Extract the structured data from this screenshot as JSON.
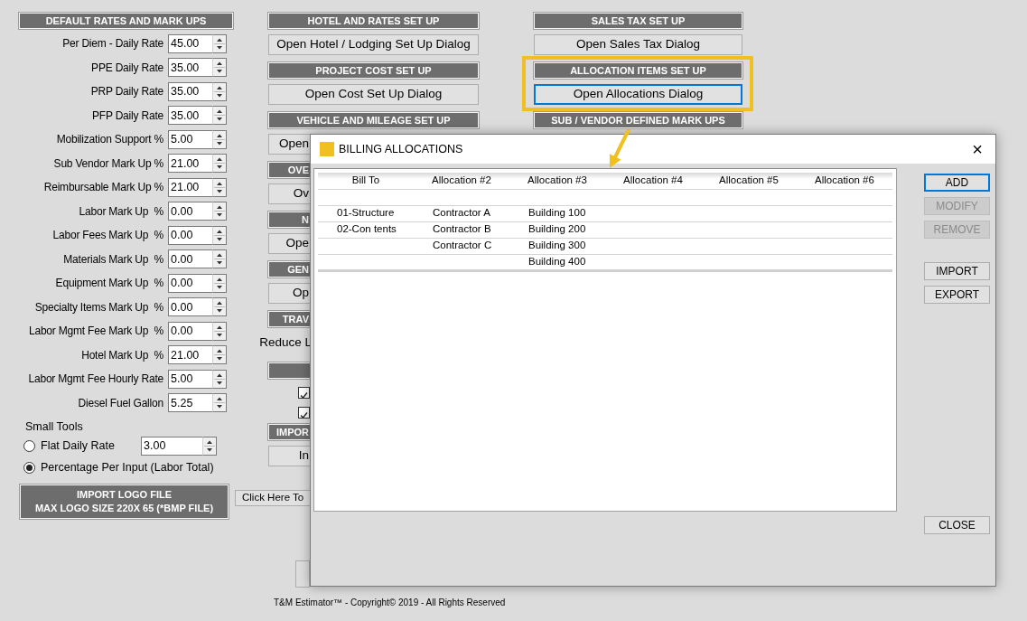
{
  "left_panel": {
    "header": "DEFAULT RATES AND MARK UPS",
    "rates": [
      {
        "label": "Per Diem - Daily Rate",
        "value": "45.00"
      },
      {
        "label": "PPE Daily Rate",
        "value": "35.00"
      },
      {
        "label": "PRP Daily Rate",
        "value": "35.00"
      },
      {
        "label": "PFP Daily Rate",
        "value": "35.00"
      },
      {
        "label": "Mobilization Support %",
        "value": "5.00"
      },
      {
        "label": "Sub Vendor Mark Up %",
        "value": "21.00"
      },
      {
        "label": "Reimbursable Mark Up %",
        "value": "21.00"
      },
      {
        "label": "Labor Mark Up  %",
        "value": "0.00"
      },
      {
        "label": "Labor Fees Mark Up  %",
        "value": "0.00"
      },
      {
        "label": "Materials Mark Up  %",
        "value": "0.00"
      },
      {
        "label": "Equipment Mark Up  %",
        "value": "0.00"
      },
      {
        "label": "Specialty Items Mark Up  %",
        "value": "0.00"
      },
      {
        "label": "Labor Mgmt Fee Mark Up  %",
        "value": "0.00"
      },
      {
        "label": "Hotel Mark Up  %",
        "value": "21.00"
      },
      {
        "label": "Labor Mgmt Fee Hourly Rate",
        "value": "5.00"
      },
      {
        "label": "Diesel Fuel Gallon",
        "value": "5.25"
      }
    ],
    "small_tools": {
      "label": "Small Tools",
      "options": [
        {
          "label": "Flat Daily Rate",
          "selected": false,
          "value": "3.00"
        },
        {
          "label": "Percentage Per Input (Labor Total)",
          "selected": true
        }
      ]
    },
    "logo_button": [
      "IMPORT LOGO FILE",
      "MAX LOGO SIZE 220X 65 (*BMP FILE)"
    ]
  },
  "middle_panel": {
    "items": [
      {
        "kind": "header",
        "text": "HOTEL AND RATES SET UP"
      },
      {
        "kind": "button",
        "text": "Open Hotel / Lodging Set Up Dialog"
      },
      {
        "kind": "header",
        "text": "PROJECT COST SET UP"
      },
      {
        "kind": "button",
        "text": "Open Cost Set Up Dialog"
      },
      {
        "kind": "header",
        "text": "VEHICLE AND MILEAGE SET UP"
      }
    ],
    "covered_items": [
      {
        "kind": "button",
        "text": "Open"
      },
      {
        "kind": "header",
        "text": "OVE"
      },
      {
        "kind": "button",
        "text": "Ov"
      },
      {
        "kind": "header",
        "text": "N"
      },
      {
        "kind": "button",
        "text": "Ope"
      },
      {
        "kind": "header",
        "text": "GEN"
      },
      {
        "kind": "button",
        "text": "Op"
      },
      {
        "kind": "header",
        "text": "TRAV"
      },
      {
        "kind": "text",
        "text": "Reduce L"
      },
      {
        "kind": "header"
      },
      {
        "kind": "checkbox",
        "checked": true
      },
      {
        "kind": "checkbox",
        "checked": true
      },
      {
        "kind": "header",
        "text": "IMPOR"
      },
      {
        "kind": "button",
        "text": "In"
      }
    ],
    "link_button": "Click Here To"
  },
  "right_panel": {
    "items": [
      {
        "kind": "header",
        "text": "SALES TAX SET UP"
      },
      {
        "kind": "button",
        "text": "Open Sales Tax Dialog",
        "focused": false
      },
      {
        "kind": "header",
        "text": "ALLOCATION ITEMS SET UP"
      },
      {
        "kind": "button",
        "text": "Open Allocations Dialog",
        "focused": true
      },
      {
        "kind": "header",
        "text": "SUB / VENDOR DEFINED MARK UPS"
      }
    ]
  },
  "dialog": {
    "title": "BILLING ALLOCATIONS",
    "close": "×",
    "columns": [
      "Bill To",
      "Allocation #2",
      "Allocation #3",
      "Allocation #4",
      "Allocation #5",
      "Allocation #6"
    ],
    "rows": [
      [
        "01-Structure",
        "Contractor A",
        "Building 100"
      ],
      [
        "02-Con tents",
        "Contractor B",
        "Building 200"
      ],
      [
        null,
        "Contractor C",
        "Building 300"
      ],
      [
        null,
        null,
        "Building 400"
      ]
    ],
    "buttons": [
      {
        "label": "ADD",
        "focused": true,
        "disabled": false
      },
      {
        "label": "MODIFY",
        "focused": false,
        "disabled": true
      },
      {
        "label": "REMOVE",
        "focused": false,
        "disabled": true
      },
      {
        "label": "IMPORT",
        "focused": false,
        "disabled": false
      },
      {
        "label": "EXPORT",
        "focused": false,
        "disabled": false
      }
    ],
    "close_button": "CLOSE"
  },
  "footer": "T&M Estimator™ - Copyright© 2019 - All Rights Reserved"
}
